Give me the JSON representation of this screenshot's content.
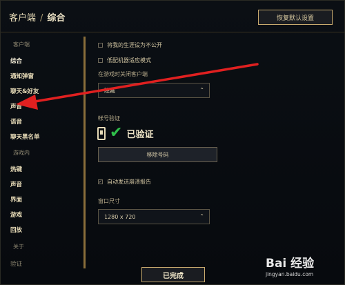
{
  "header": {
    "breadcrumb_root": "客户端",
    "breadcrumb_sep": "/",
    "breadcrumb_current": "综合",
    "restore_defaults_label": "恢复默认设置"
  },
  "sidebar": {
    "client_section": "客户端",
    "client_items": [
      {
        "label": "综合",
        "active": true
      },
      {
        "label": "通知弹窗"
      },
      {
        "label": "聊天&好友"
      },
      {
        "label": "声音"
      },
      {
        "label": "语音"
      },
      {
        "label": "聊天黑名单"
      }
    ],
    "ingame_section": "游戏内",
    "ingame_items": [
      {
        "label": "热键"
      },
      {
        "label": "声音"
      },
      {
        "label": "界面"
      },
      {
        "label": "游戏"
      },
      {
        "label": "回放"
      }
    ],
    "about_section": "关于",
    "about_items": [
      {
        "label": "验证"
      }
    ]
  },
  "main": {
    "hide_career_label": "将我的生涯设为不公开",
    "hide_career_checked": false,
    "low_spec_label": "低配机器适应模式",
    "low_spec_checked": false,
    "close_client_label": "在游戏时关闭客户端",
    "close_client_value": "隐藏",
    "account_verify_label": "帐号验证",
    "verified_text": "已验证",
    "remove_phone_label": "移除号码",
    "auto_crash_label": "自动发送崩溃报告",
    "auto_crash_checked": true,
    "window_size_label": "窗口尺寸",
    "window_size_value": "1280 x 720"
  },
  "footer": {
    "done_label": "已完成"
  },
  "watermark": {
    "logo": "Bai 经验",
    "url": "jingyan.baidu.com"
  },
  "colors": {
    "accent_gold": "#c8aa6e",
    "check_green": "#2fbf4a",
    "arrow_red": "#e02020"
  }
}
